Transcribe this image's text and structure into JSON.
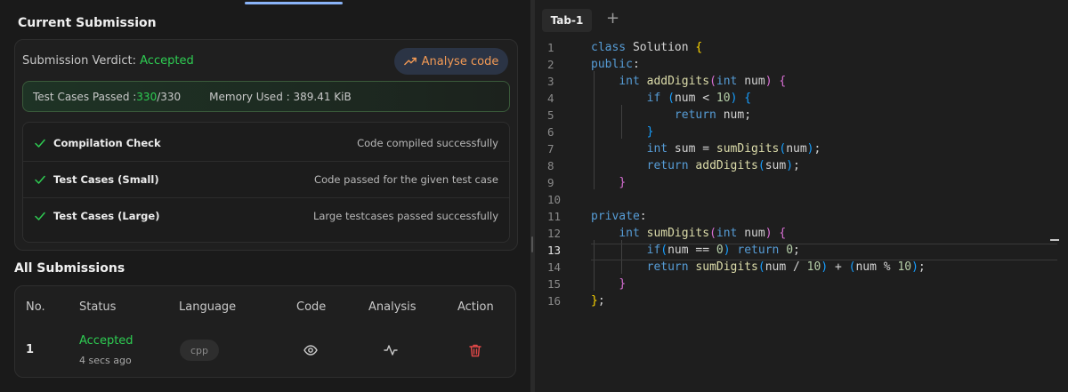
{
  "current_submission": {
    "title": "Current Submission",
    "verdict_label": "Submission Verdict:",
    "verdict_value": "Accepted",
    "analyse_button": "Analyse code",
    "tests_label": "Test Cases Passed : ",
    "tests_passed": "330",
    "tests_total": "/330",
    "memory_label": "Memory Used : 389.41 KiB",
    "checks": [
      {
        "name": "Compilation Check",
        "message": "Code compiled successfully"
      },
      {
        "name": "Test Cases (Small)",
        "message": "Code passed for the given test case"
      },
      {
        "name": "Test Cases (Large)",
        "message": "Large testcases passed successfully"
      }
    ]
  },
  "all_submissions": {
    "title": "All Submissions",
    "headers": [
      "No.",
      "Status",
      "Language",
      "Code",
      "Analysis",
      "Action"
    ],
    "rows": [
      {
        "no": "1",
        "status": "Accepted",
        "time": "4 secs ago",
        "language": "cpp"
      }
    ]
  },
  "editor": {
    "tab_label": "Tab-1",
    "add_tab": "+",
    "line_numbers": [
      "1",
      "2",
      "3",
      "4",
      "5",
      "6",
      "7",
      "8",
      "9",
      "10",
      "11",
      "12",
      "13",
      "14",
      "15",
      "16"
    ],
    "active_line": 13,
    "lines": [
      "class Solution {",
      "public:",
      "    int addDigits(int num) {",
      "        if (num < 10) {",
      "            return num;",
      "        }",
      "        int sum = sumDigits(num);",
      "        return addDigits(sum);",
      "    }",
      "",
      "private:",
      "    int sumDigits(int num) {",
      "        if(num == 0) return 0;",
      "        return sumDigits(num / 10) + (num % 10);",
      "    }",
      "};"
    ]
  },
  "colors": {
    "accepted": "#2ecc52",
    "analyse_text": "#f39a55",
    "delete_icon": "#e04848",
    "tab_indicator": "#8ab4f8"
  }
}
